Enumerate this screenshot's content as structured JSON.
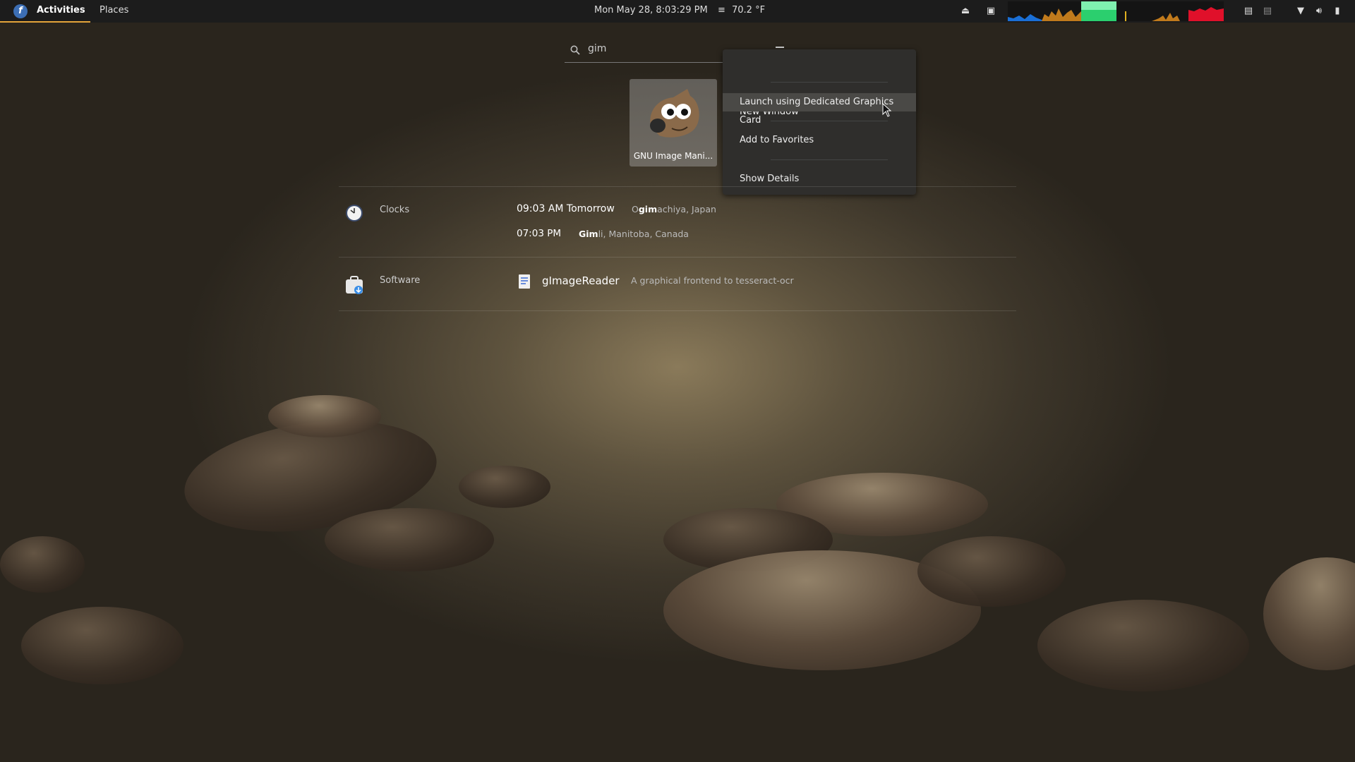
{
  "topbar": {
    "activities_label": "Activities",
    "places_label": "Places",
    "datetime": "Mon May 28,  8:03:29 PM",
    "weather": "70.2 °F"
  },
  "search": {
    "value": "gim",
    "placeholder": ""
  },
  "app_result": {
    "name": "GNU Image Mani..."
  },
  "context_menu": {
    "items": [
      "New Window",
      "Launch using Dedicated Graphics Card",
      "Add to Favorites",
      "Show Details"
    ]
  },
  "results": {
    "clocks": {
      "provider": "Clocks",
      "entries": [
        {
          "time": "09:03 AM Tomorrow",
          "place_prefix": "O",
          "place_match": "gim",
          "place_rest": "achiya, Japan"
        },
        {
          "time": "07:03 PM",
          "place_prefix": "",
          "place_match": "Gim",
          "place_rest": "li, Manitoba, Canada"
        }
      ]
    },
    "software": {
      "provider": "Software",
      "app_name": "gImageReader",
      "description": "A graphical frontend to tesseract-ocr"
    }
  },
  "colors": {
    "accent": "#e4a43a",
    "menu_bg": "#2f2e2c",
    "topbar_bg": "#1c1c1c"
  }
}
